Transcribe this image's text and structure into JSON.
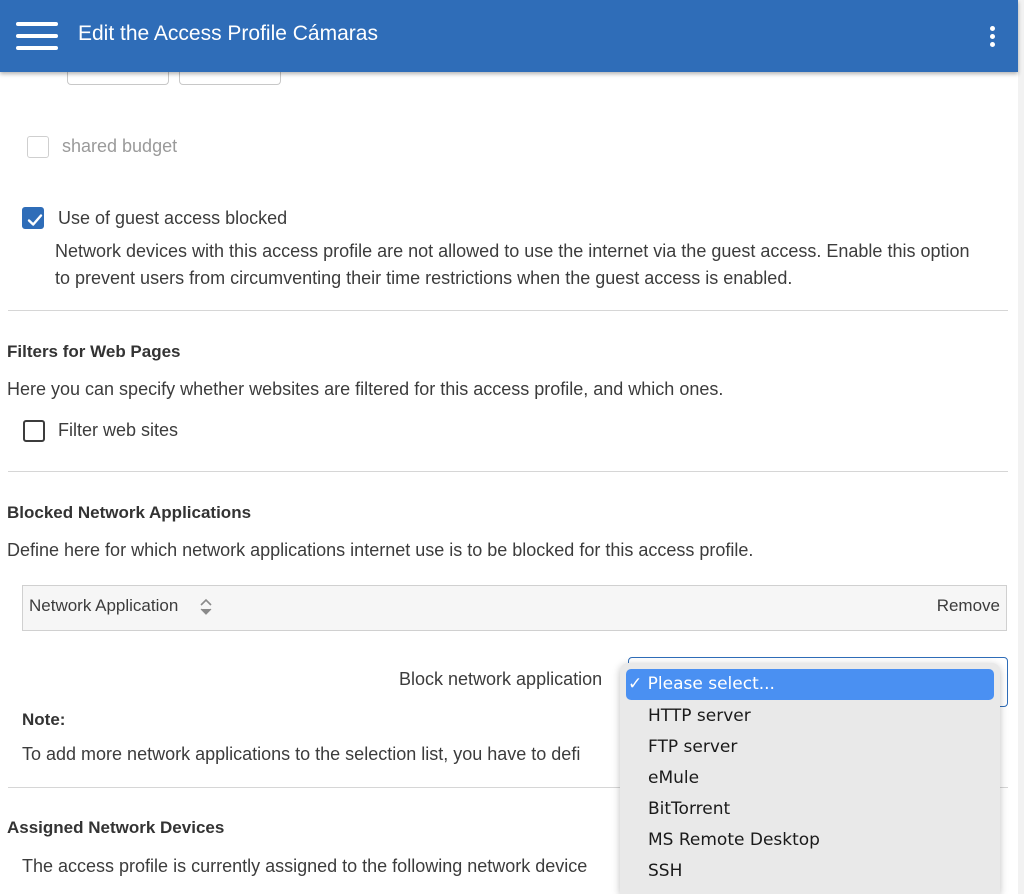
{
  "header": {
    "title": "Edit the Access Profile Cámaras"
  },
  "shared_budget": {
    "label": "shared budget",
    "checked": false,
    "disabled": true
  },
  "guest_access": {
    "label": "Use of guest access blocked",
    "checked": true,
    "description": "Network devices with this access profile are not allowed to use the internet via the guest access. Enable this option to prevent users from circumventing their time restrictions when the guest access is enabled."
  },
  "web_filters": {
    "heading": "Filters for Web Pages",
    "description": "Here you can specify whether websites are filtered for this access profile, and which ones.",
    "filter_label": "Filter web sites",
    "checked": false
  },
  "blocked_apps": {
    "heading": "Blocked Network Applications",
    "description": "Define here for which network applications internet use is to be blocked for this access profile.",
    "table": {
      "col_application": "Network Application",
      "col_remove": "Remove"
    },
    "block_label": "Block network application",
    "note_heading": "Note:",
    "note_text": "To add more network applications to the selection list, you have to defi",
    "dropdown": {
      "checkmark": "✓",
      "options": [
        "Please select...",
        "HTTP server",
        "FTP server",
        "eMule",
        "BitTorrent",
        "MS Remote Desktop",
        "SSH"
      ],
      "selected_index": 0
    }
  },
  "assigned_devices": {
    "heading": "Assigned Network Devices",
    "description": "The access profile is currently assigned to the following network device"
  }
}
